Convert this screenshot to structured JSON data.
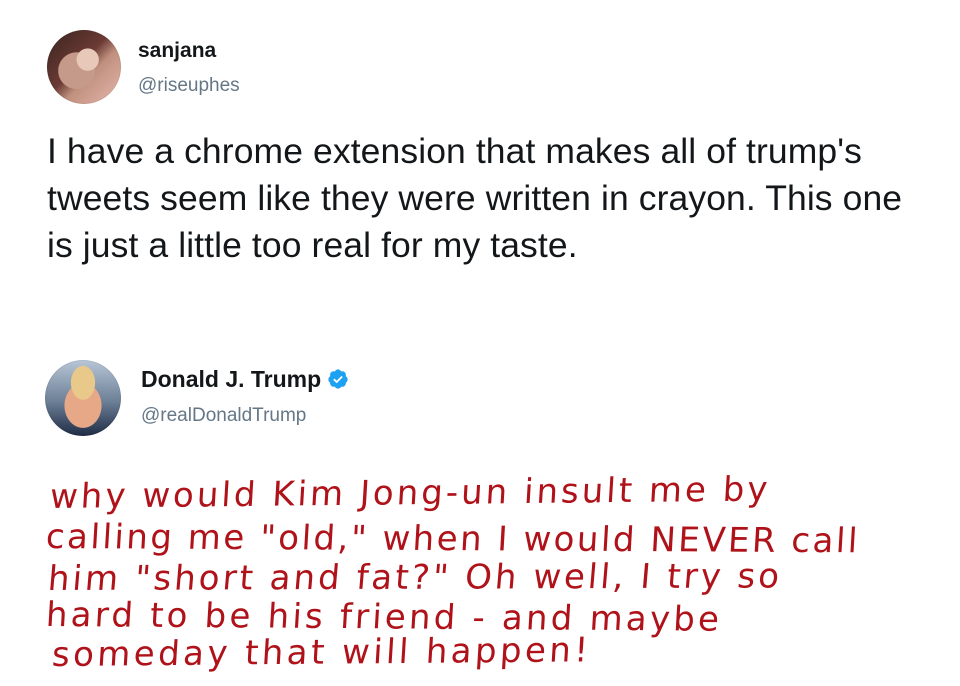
{
  "quoting_tweet": {
    "author": {
      "name": "sanjana",
      "handle": "@riseuphes",
      "avatar_icon": "user-avatar-photo"
    },
    "text": "I have a chrome extension that makes all of trump's tweets seem like they were written in crayon. This one is just a little too real for my taste."
  },
  "quoted_tweet": {
    "author": {
      "name": "Donald J. Trump",
      "handle": "@realDonaldTrump",
      "verified": true,
      "verified_icon": "verified-badge-icon",
      "verified_color": "#1da1f2",
      "avatar_icon": "user-avatar-photo"
    },
    "crayon_color": "#b0121a",
    "crayon_lines": [
      "why would Kim Jong-un insult me by",
      "calling me \"old,\" when I would NEVER call",
      "him \"short and fat?\" Oh well, I try so",
      "hard to be his friend - and maybe",
      "someday that will happen!"
    ]
  }
}
